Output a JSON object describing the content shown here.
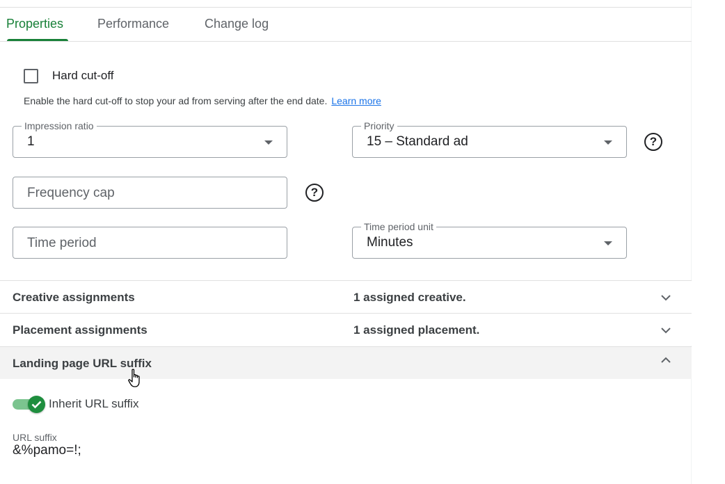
{
  "tabs": [
    {
      "label": "Properties",
      "active": true
    },
    {
      "label": "Performance",
      "active": false
    },
    {
      "label": "Change log",
      "active": false
    }
  ],
  "hard_cutoff": {
    "label": "Hard cut-off",
    "checked": false,
    "hint": "Enable the hard cut-off to stop your ad from serving after the end date.",
    "learn_more": "Learn more"
  },
  "impression_ratio": {
    "label": "Impression ratio",
    "value": "1"
  },
  "priority": {
    "label": "Priority",
    "value": "15 – Standard ad",
    "help_icon": "help-circle-icon"
  },
  "frequency_cap": {
    "placeholder": "Frequency cap",
    "help_icon": "help-circle-icon"
  },
  "time_period": {
    "placeholder": "Time period"
  },
  "time_period_unit": {
    "label": "Time period unit",
    "value": "Minutes"
  },
  "sections": [
    {
      "title": "Creative assignments",
      "summary": "1 assigned creative.",
      "expanded": false,
      "icon": "chevron-down-icon"
    },
    {
      "title": "Placement assignments",
      "summary": "1 assigned placement.",
      "expanded": false,
      "icon": "chevron-down-icon"
    },
    {
      "title": "Landing page URL suffix",
      "summary": "",
      "expanded": true,
      "icon": "chevron-up-icon"
    }
  ],
  "inherit_url_suffix": {
    "label": "Inherit URL suffix",
    "on": true
  },
  "url_suffix": {
    "label": "URL suffix",
    "value": "&%pamo=!;"
  },
  "colors": {
    "accent_green": "#188038",
    "toggle_green": "#1e8e3e",
    "link_blue": "#1a73e8"
  }
}
